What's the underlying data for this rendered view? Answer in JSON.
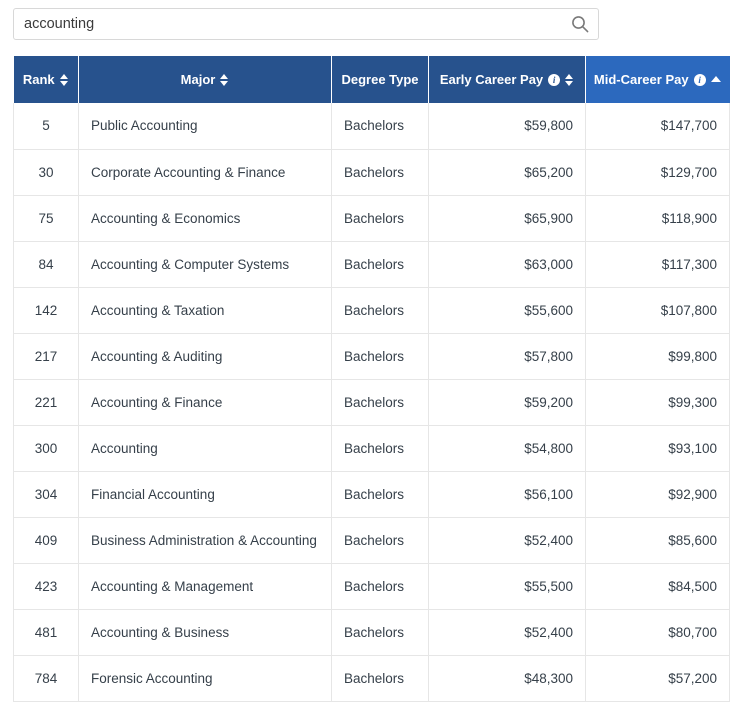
{
  "search": {
    "value": "accounting",
    "placeholder": "Search",
    "icon": "search-icon"
  },
  "table": {
    "columns": [
      {
        "key": "rank",
        "label": "Rank",
        "align": "center",
        "sortable": true,
        "sort_state": "none",
        "info": false
      },
      {
        "key": "major",
        "label": "Major",
        "align": "center",
        "sortable": true,
        "sort_state": "none",
        "info": false
      },
      {
        "key": "degree",
        "label": "Degree Type",
        "align": "center",
        "sortable": false,
        "sort_state": "none",
        "info": false
      },
      {
        "key": "early",
        "label": "Early Career Pay",
        "align": "center",
        "sortable": true,
        "sort_state": "none",
        "info": true
      },
      {
        "key": "mid",
        "label": "Mid-Career Pay",
        "align": "center",
        "sortable": true,
        "sort_state": "asc",
        "info": true
      }
    ],
    "info_glyph": "i",
    "rows": [
      {
        "rank": "5",
        "major": "Public Accounting",
        "degree": "Bachelors",
        "early": "$59,800",
        "mid": "$147,700"
      },
      {
        "rank": "30",
        "major": "Corporate Accounting & Finance",
        "degree": "Bachelors",
        "early": "$65,200",
        "mid": "$129,700"
      },
      {
        "rank": "75",
        "major": "Accounting & Economics",
        "degree": "Bachelors",
        "early": "$65,900",
        "mid": "$118,900"
      },
      {
        "rank": "84",
        "major": "Accounting & Computer Systems",
        "degree": "Bachelors",
        "early": "$63,000",
        "mid": "$117,300"
      },
      {
        "rank": "142",
        "major": "Accounting & Taxation",
        "degree": "Bachelors",
        "early": "$55,600",
        "mid": "$107,800"
      },
      {
        "rank": "217",
        "major": "Accounting & Auditing",
        "degree": "Bachelors",
        "early": "$57,800",
        "mid": "$99,800"
      },
      {
        "rank": "221",
        "major": "Accounting & Finance",
        "degree": "Bachelors",
        "early": "$59,200",
        "mid": "$99,300"
      },
      {
        "rank": "300",
        "major": "Accounting",
        "degree": "Bachelors",
        "early": "$54,800",
        "mid": "$93,100"
      },
      {
        "rank": "304",
        "major": "Financial Accounting",
        "degree": "Bachelors",
        "early": "$56,100",
        "mid": "$92,900"
      },
      {
        "rank": "409",
        "major": "Business Administration & Accounting",
        "degree": "Bachelors",
        "early": "$52,400",
        "mid": "$85,600"
      },
      {
        "rank": "423",
        "major": "Accounting & Management",
        "degree": "Bachelors",
        "early": "$55,500",
        "mid": "$84,500"
      },
      {
        "rank": "481",
        "major": "Accounting & Business",
        "degree": "Bachelors",
        "early": "$52,400",
        "mid": "$80,700"
      },
      {
        "rank": "784",
        "major": "Forensic Accounting",
        "degree": "Bachelors",
        "early": "$48,300",
        "mid": "$57,200"
      }
    ]
  },
  "colors": {
    "header_blue": "#27528D",
    "header_blue_active": "#2C69BE",
    "cell_text": "#36404A",
    "grid_line": "#e6e6e6"
  }
}
